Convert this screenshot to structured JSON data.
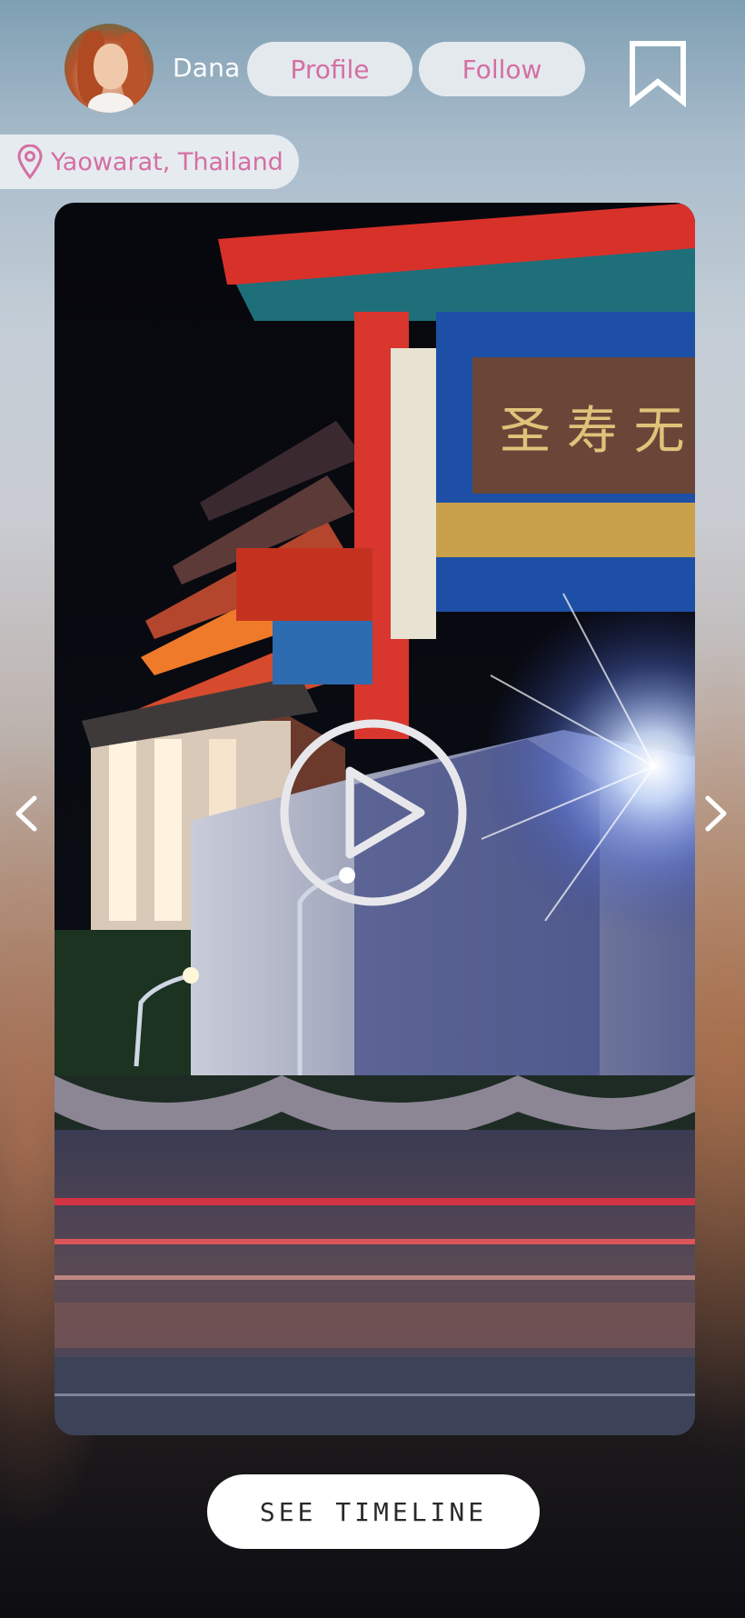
{
  "user": {
    "name": "Dana",
    "avatar_icon": "avatar-photo"
  },
  "actions": {
    "profile_label": "Profile",
    "follow_label": "Follow",
    "bookmark_icon": "bookmark-icon"
  },
  "location": {
    "icon": "location-pin-icon",
    "label": "Yaowarat, Thailand"
  },
  "media": {
    "type": "video",
    "play_icon": "play-icon",
    "prev_icon": "chevron-left-icon",
    "next_icon": "chevron-right-icon"
  },
  "footer": {
    "timeline_label": "SEE TIMELINE"
  },
  "colors": {
    "accent_pink": "#d46fa3",
    "pill_bg": "#e4e9ee",
    "button_bg": "#ffffff"
  }
}
